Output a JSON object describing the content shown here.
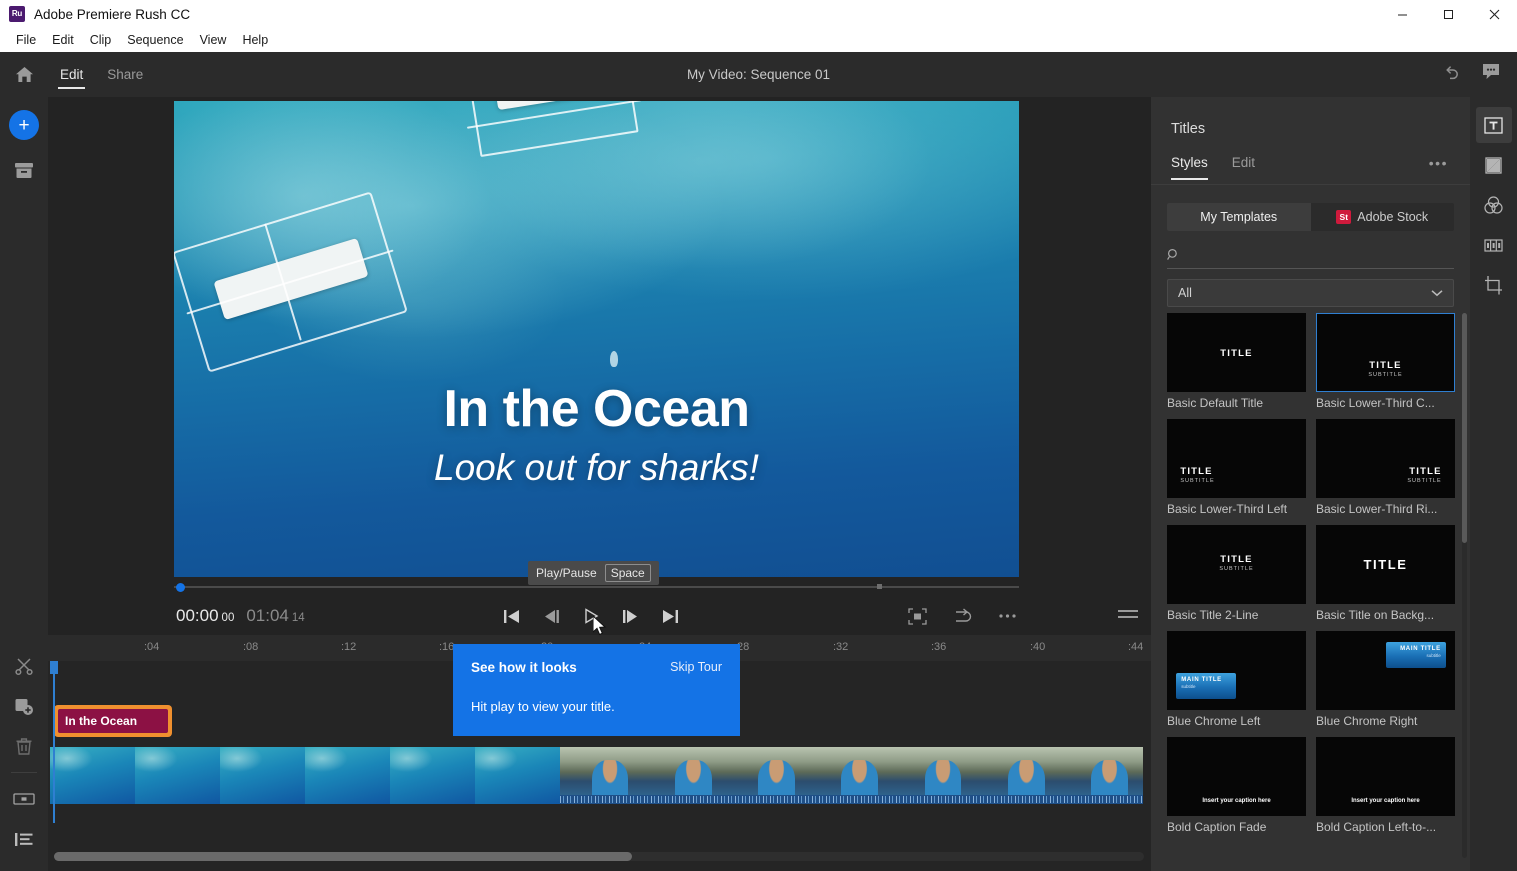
{
  "window": {
    "app_badge": "Ru",
    "title": "Adobe Premiere Rush CC",
    "minimize": "–",
    "maximize": "□",
    "close": "✕"
  },
  "menubar": {
    "items": [
      "File",
      "Edit",
      "Clip",
      "Sequence",
      "View",
      "Help"
    ]
  },
  "header": {
    "home_icon": "home-icon",
    "tabs": [
      {
        "label": "Edit",
        "active": true
      },
      {
        "label": "Share",
        "active": false
      }
    ],
    "project_title": "My Video: Sequence 01",
    "undo_icon": "undo-icon",
    "feedback_icon": "feedback-chat-icon"
  },
  "left_rail": {
    "add_label": "+",
    "items": [
      "add-media-button",
      "project-media-icon",
      "cut-tool-icon",
      "duplicate-icon",
      "delete-icon",
      "transitions-icon",
      "list-view-icon"
    ]
  },
  "right_rail": {
    "items": [
      {
        "name": "titles-icon",
        "active": true
      },
      {
        "name": "transitions-icon",
        "active": false
      },
      {
        "name": "color-icon",
        "active": false
      },
      {
        "name": "effects-icon",
        "active": false
      },
      {
        "name": "crop-transform-icon",
        "active": false
      }
    ]
  },
  "preview": {
    "title_overlay": {
      "line1": "In the Ocean",
      "line2": "Look out for sharks!"
    },
    "timecode_current": "00:00",
    "timecode_current_frames": "00",
    "timecode_duration": "01:04",
    "timecode_duration_frames": "14",
    "tooltip": {
      "label": "Play/Pause",
      "key": "Space"
    },
    "controls": [
      "go-to-start-button",
      "step-back-button",
      "play-pause-button",
      "step-forward-button",
      "go-to-end-button",
      "fullscreen-button",
      "export-button",
      "more-options-button",
      "menu-button"
    ]
  },
  "timeline": {
    "ruler_ticks": [
      ":04",
      ":08",
      ":12",
      ":16",
      ":20",
      ":24",
      ":28",
      ":32",
      ":36",
      ":40",
      ":44"
    ],
    "title_clip_label": "In the Ocean"
  },
  "tour": {
    "title": "See how it looks",
    "skip": "Skip Tour",
    "body": "Hit play to view your title."
  },
  "panel": {
    "title": "Titles",
    "tabs": [
      {
        "label": "Styles",
        "active": true
      },
      {
        "label": "Edit",
        "active": false
      }
    ],
    "more_label": "•••",
    "segments": [
      {
        "label": "My Templates",
        "active": true,
        "badge": null
      },
      {
        "label": "Adobe Stock",
        "active": false,
        "badge": "St"
      }
    ],
    "search": {
      "value": "",
      "placeholder": "",
      "icon": "search-icon"
    },
    "filter": {
      "value": "All",
      "caret": "chevron-down-icon"
    },
    "templates": [
      {
        "label": "Basic Default Title",
        "selected": false,
        "preview": "center-title",
        "title": "TITLE",
        "subtitle": ""
      },
      {
        "label": "Basic Lower-Third C...",
        "selected": true,
        "preview": "lower-center",
        "title": "TITLE",
        "subtitle": "SUBTITLE"
      },
      {
        "label": "Basic Lower-Third Left",
        "selected": false,
        "preview": "lower-left",
        "title": "TITLE",
        "subtitle": "SUBTITLE"
      },
      {
        "label": "Basic Lower-Third Ri...",
        "selected": false,
        "preview": "lower-right",
        "title": "TITLE",
        "subtitle": "SUBTITLE"
      },
      {
        "label": "Basic Title 2-Line",
        "selected": false,
        "preview": "center-two-line",
        "title": "TITLE",
        "subtitle": "SUBTITLE"
      },
      {
        "label": "Basic Title on Backg...",
        "selected": false,
        "preview": "center-big",
        "title": "TITLE",
        "subtitle": ""
      },
      {
        "label": "Blue Chrome Left",
        "selected": false,
        "preview": "chrome-left",
        "title": "MAIN TITLE",
        "subtitle": "subtitle"
      },
      {
        "label": "Blue Chrome Right",
        "selected": false,
        "preview": "chrome-right",
        "title": "MAIN TITLE",
        "subtitle": "subtitle"
      },
      {
        "label": "Bold Caption Fade",
        "selected": false,
        "preview": "caption",
        "title": "Insert your caption here",
        "subtitle": ""
      },
      {
        "label": "Bold Caption Left-to-...",
        "selected": false,
        "preview": "caption",
        "title": "Insert your caption here",
        "subtitle": ""
      }
    ]
  },
  "colors": {
    "accent_blue": "#1473e6",
    "playhead_blue": "#2f7fd1",
    "clip_orange": "#f0902f",
    "clip_magenta": "#8c1144",
    "stock_red": "#cf1a3c"
  }
}
